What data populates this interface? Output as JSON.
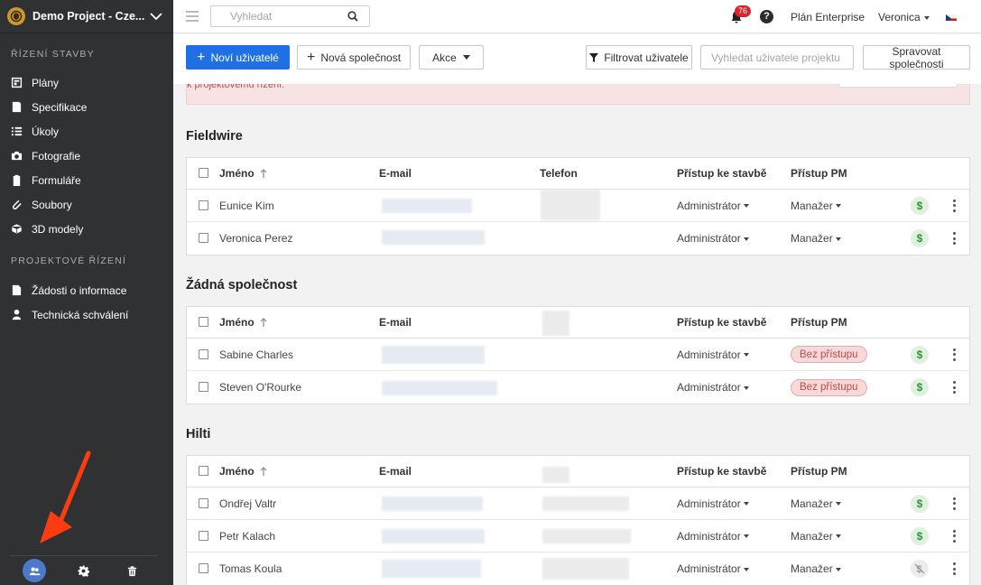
{
  "sidebar": {
    "project_name": "Demo Project - Cze...",
    "sections": [
      {
        "title": "ŘÍZENÍ STAVBY",
        "items": [
          {
            "label": "Plány",
            "icon": "plans-icon"
          },
          {
            "label": "Specifikace",
            "icon": "specifications-icon"
          },
          {
            "label": "Úkoly",
            "icon": "tasks-list-icon"
          },
          {
            "label": "Fotografie",
            "icon": "camera-icon"
          },
          {
            "label": "Formuláře",
            "icon": "forms-clipboard-icon"
          },
          {
            "label": "Soubory",
            "icon": "paperclip-icon"
          },
          {
            "label": "3D modely",
            "icon": "cube-icon"
          }
        ]
      },
      {
        "title": "PROJEKTOVÉ ŘÍZENÍ",
        "items": [
          {
            "label": "Žádosti o informace",
            "icon": "rfi-document-icon"
          },
          {
            "label": "Technická schválení",
            "icon": "submittal-person-icon"
          }
        ]
      }
    ],
    "bottom": [
      {
        "name": "users-icon",
        "active": true
      },
      {
        "name": "gear-icon",
        "active": false
      },
      {
        "name": "trash-icon",
        "active": false
      }
    ]
  },
  "topbar": {
    "search_placeholder": "Vyhledat",
    "notification_count": "76",
    "help_label": "?",
    "plan_label": "Plán Enterprise",
    "user_name": "Veronica",
    "language": "czech-flag-icon"
  },
  "actions": {
    "new_users": "Noví uživatelé",
    "new_company": "Nová společnost",
    "actions": "Akce",
    "filter_users": "Filtrovat uživatele",
    "search_project_users_placeholder": "Vyhledat uživatele projektu",
    "manage_companies": "Spravovat společnosti"
  },
  "alert_text": "k projektovému řízení.",
  "columns": {
    "name": "Jméno",
    "email": "E-mail",
    "phone": "Telefon",
    "site_access": "Přístup ke stavbě",
    "pm_access": "Přístup PM"
  },
  "groups": [
    {
      "title": "Fieldwire",
      "show_phone_header": true,
      "rows": [
        {
          "name": "Eunice Kim",
          "site": "Administrátor",
          "pm": "Manažer",
          "pm_no_access": false,
          "billing_active": true
        },
        {
          "name": "Veronica Perez",
          "site": "Administrátor",
          "pm": "Manažer",
          "pm_no_access": false,
          "billing_active": true
        }
      ]
    },
    {
      "title": "Žádná společnost",
      "show_phone_header": false,
      "rows": [
        {
          "name": "Sabine Charles",
          "site": "Administrátor",
          "pm": "Bez přístupu",
          "pm_no_access": true,
          "billing_active": true
        },
        {
          "name": "Steven O'Rourke",
          "site": "Administrátor",
          "pm": "Bez přístupu",
          "pm_no_access": true,
          "billing_active": true
        }
      ]
    },
    {
      "title": "Hilti",
      "show_phone_header": false,
      "rows": [
        {
          "name": "Ondřej Valtr",
          "site": "Administrátor",
          "pm": "Manažer",
          "pm_no_access": false,
          "billing_active": true
        },
        {
          "name": "Petr Kalach",
          "site": "Administrátor",
          "pm": "Manažer",
          "pm_no_access": false,
          "billing_active": true
        },
        {
          "name": "Tomas Koula",
          "site": "Administrátor",
          "pm": "Manažer",
          "pm_no_access": false,
          "billing_active": false
        }
      ]
    }
  ],
  "colors": {
    "sidebar_bg": "#2f3133",
    "primary": "#1f6fe5",
    "billing_green": "#2f9440",
    "no_access_red": "#c04a4a",
    "notification_red": "#d7262b"
  }
}
